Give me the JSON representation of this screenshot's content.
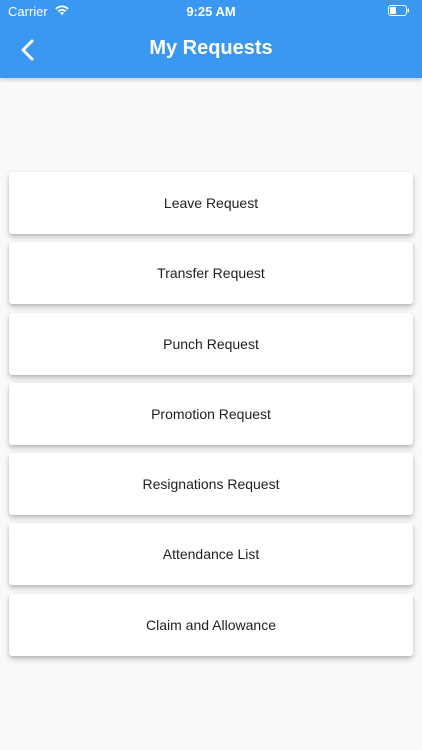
{
  "theme": {
    "accent": "#3a98f2"
  },
  "status_bar": {
    "carrier": "Carrier",
    "time": "9:25 AM",
    "wifi_icon": "wifi-icon",
    "battery_icon": "battery-icon"
  },
  "header": {
    "back_icon": "chevron-left-icon",
    "title": "My Requests"
  },
  "requests": {
    "items": [
      {
        "label": "Leave Request"
      },
      {
        "label": "Transfer Request"
      },
      {
        "label": "Punch Request"
      },
      {
        "label": "Promotion Request"
      },
      {
        "label": "Resignations Request"
      },
      {
        "label": "Attendance List"
      },
      {
        "label": "Claim and Allowance"
      }
    ]
  }
}
